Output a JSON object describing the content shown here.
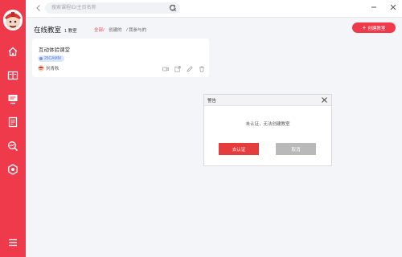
{
  "search": {
    "placeholder": "搜索课程ID/主页名称"
  },
  "header": {
    "title": "在线教室",
    "count": "1 教室",
    "filters": [
      "全部/",
      "创建的",
      "/ 我参与的"
    ],
    "create_button": "创建教室"
  },
  "card": {
    "title": "互动体验课堂",
    "code": "25CAMM",
    "owner": "刘青秋"
  },
  "dialog": {
    "title": "警告",
    "message": "未认证，无法创建教室",
    "confirm": "去认证",
    "cancel": "取消"
  },
  "colors": {
    "brand_red": "#ee3a4a",
    "badge_blue": "#dbe6fb",
    "cancel_gray": "#b9b9b9"
  }
}
